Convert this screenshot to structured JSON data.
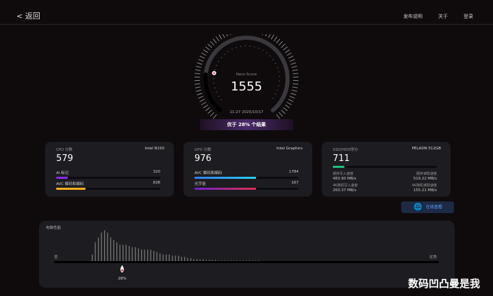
{
  "header": {
    "back_label": "< 返回",
    "nav": [
      "发布说明",
      "关于",
      "登录"
    ]
  },
  "gauge": {
    "label": "Nero Score",
    "score": "1555",
    "timestamp": "11:27 2025/10/17",
    "beat_text": "优于 28% 个结果",
    "percentile": 28,
    "accent_start": "#ff4060",
    "accent_end": "#ffd030"
  },
  "cpu": {
    "title": "CPU 分数",
    "device": "Intel N150",
    "score": "579",
    "items": [
      {
        "label": "AI 标记",
        "value": "320",
        "fill": 0.11,
        "color": "#8a2be2"
      },
      {
        "label": "AVC 解码和编码",
        "value": "838",
        "fill": 0.28,
        "color": "#ffb020"
      }
    ]
  },
  "gpu": {
    "title": "GPU 分数",
    "device": "Intel Graphics",
    "score": "976",
    "items": [
      {
        "label": "AVC 解码和编码",
        "value": "1784",
        "fill": 0.59,
        "color": "#2ad0f0"
      },
      {
        "label": "光宇宙",
        "value": "167",
        "fill": 0.59,
        "color": "#e03050"
      }
    ]
  },
  "ssd": {
    "title": "SSD/HDD得分",
    "device": "PELADN 512GB",
    "score": "711",
    "fill": 0.11,
    "color": "#20c080",
    "stats": [
      {
        "label": "顺序写入速度",
        "value": "483.90 MB/s"
      },
      {
        "label": "顺序读取速度",
        "value": "519.22 MB/s"
      },
      {
        "label": "4K随机写入速度",
        "value": "263.37 MB/s"
      },
      {
        "label": "4K随机读取速度",
        "value": "155.21 MB/s"
      }
    ]
  },
  "online_button": "在线查看",
  "performance": {
    "title": "电脑性能",
    "low_label": "差",
    "high_label": "优秀",
    "marker_label": "28%",
    "marker_percent": 28,
    "distribution": [
      6,
      16,
      20,
      24,
      26,
      24,
      20,
      18,
      16,
      14,
      14,
      14,
      13,
      12,
      12,
      11,
      10,
      10,
      10,
      10,
      9,
      8,
      7,
      6,
      6,
      6,
      5,
      5,
      5,
      4,
      4,
      3,
      3,
      2,
      2,
      2,
      2,
      1.5,
      1.5,
      1.5,
      1.5,
      1,
      1,
      1,
      1,
      1,
      1,
      1,
      1,
      1,
      1,
      1,
      1,
      1,
      1
    ]
  },
  "watermark": "数码凹凸曼是我"
}
